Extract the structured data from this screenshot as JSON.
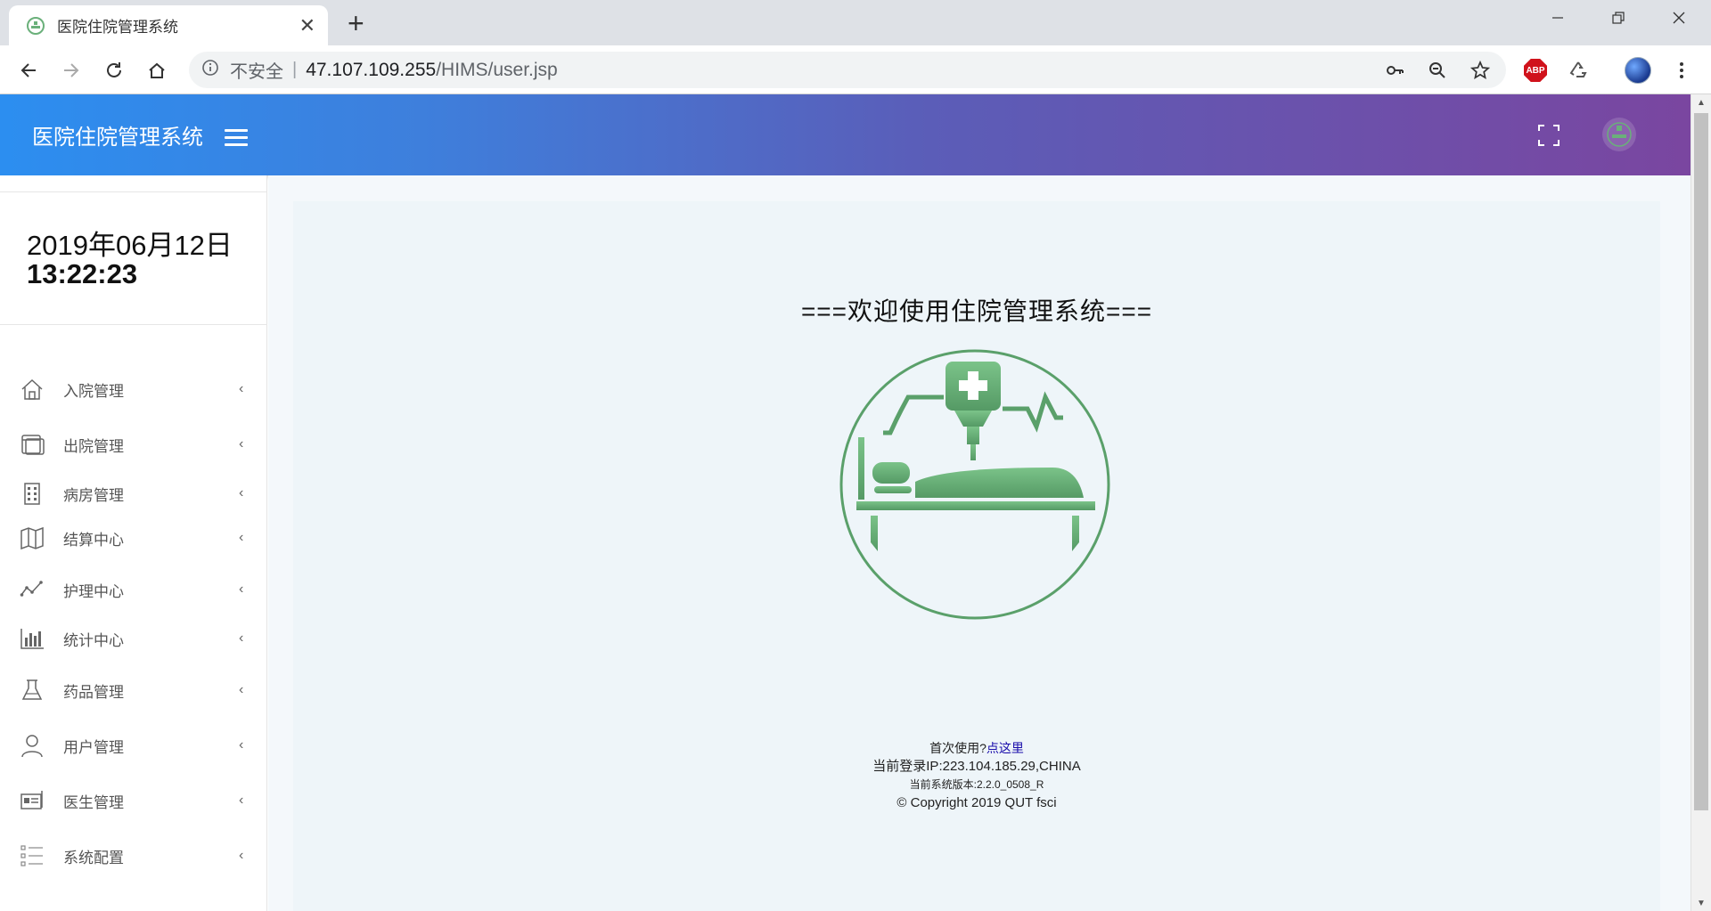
{
  "browser": {
    "tab_title": "医院住院管理系统",
    "new_tab": "+",
    "close": "✕",
    "address": {
      "security_label": "不安全",
      "separator": "|",
      "host": "47.107.109.255",
      "path": "/HIMS/user.jsp"
    },
    "extensions": {
      "abp_label": "ABP"
    }
  },
  "app": {
    "title": "医院住院管理系统",
    "accent_gradient": [
      "#2c8ef0",
      "#7a46a0"
    ],
    "logo_color": "#6ab07a"
  },
  "sidebar": {
    "date": "2019年06月12日",
    "time": "13:22:23",
    "items": [
      {
        "label": "入院管理",
        "icon": "home-icon"
      },
      {
        "label": "出院管理",
        "icon": "window-icon"
      },
      {
        "label": "病房管理",
        "icon": "building-icon"
      },
      {
        "label": "结算中心",
        "icon": "map-icon"
      },
      {
        "label": "护理中心",
        "icon": "line-chart-icon"
      },
      {
        "label": "统计中心",
        "icon": "bar-chart-icon"
      },
      {
        "label": "药品管理",
        "icon": "flask-icon"
      },
      {
        "label": "用户管理",
        "icon": "user-icon"
      },
      {
        "label": "医生管理",
        "icon": "id-card-icon"
      },
      {
        "label": "系统配置",
        "icon": "list-icon"
      }
    ],
    "chevron": "‹"
  },
  "main": {
    "welcome": "===欢迎使用住院管理系统===",
    "footer": {
      "first_use_prefix": "首次使用?",
      "first_use_link": "点这里",
      "login_ip": "当前登录IP:223.104.185.29,CHINA",
      "version": "当前系统版本:2.2.0_0508_R",
      "copyright": "© Copyright 2019 QUT fsci"
    }
  }
}
